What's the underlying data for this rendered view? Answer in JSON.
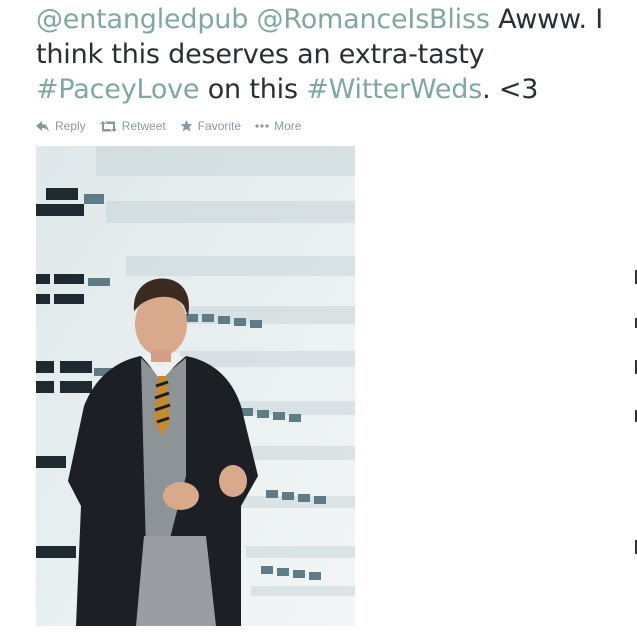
{
  "tweet": {
    "mention_1": "@entangledpub",
    "mention_2": "@RomanceIsBliss",
    "text_1": " Awww. I think this deserves an extra-tasty ",
    "hashtag_1": "#PaceyLove",
    "text_2": " on this ",
    "hashtag_2": "#WitterWeds",
    "text_3": ". <3"
  },
  "actions": {
    "reply_label": "Reply",
    "retweet_label": "Retweet",
    "favorite_label": "Favorite",
    "more_label": "More"
  },
  "colors": {
    "link": "#7fa8a0",
    "text": "#292f33",
    "action": "#8899a6"
  },
  "icons": [
    "reply-icon",
    "retweet-icon",
    "star-icon",
    "more-dots-icon"
  ]
}
